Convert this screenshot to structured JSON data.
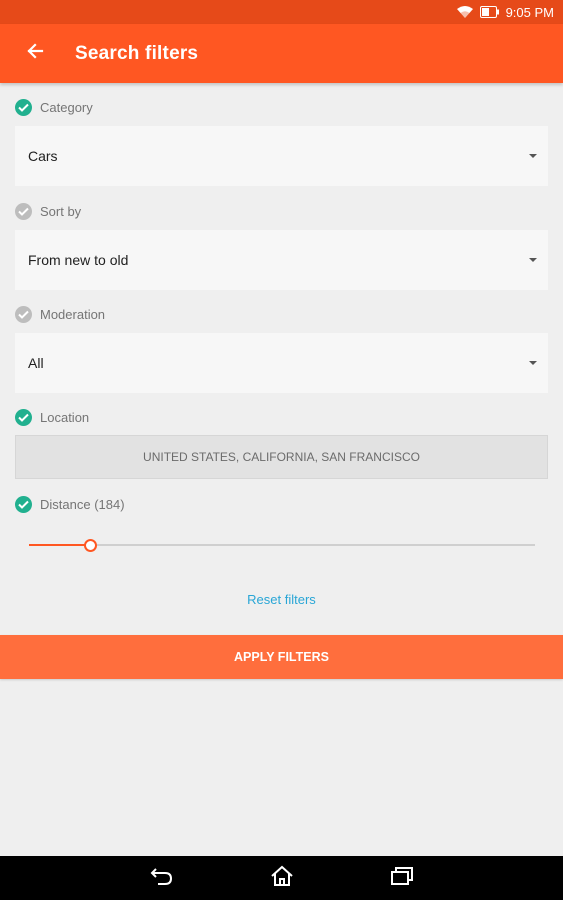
{
  "colors": {
    "status_bar": "#e64a19",
    "app_bar": "#ff5722",
    "check_active": "#21b08f",
    "check_inactive": "#bdbdbd",
    "link": "#29a6d6",
    "apply_button": "#ff6e3d"
  },
  "status_bar": {
    "time": "9:05 PM",
    "icons": [
      "wifi-icon",
      "battery-icon"
    ]
  },
  "app_bar": {
    "title": "Search filters",
    "back_icon": "arrow-left-icon"
  },
  "filters": {
    "category": {
      "label": "Category",
      "value": "Cars",
      "checked": true
    },
    "sort_by": {
      "label": "Sort by",
      "value": "From new to old",
      "checked": false
    },
    "moderation": {
      "label": "Moderation",
      "value": "All",
      "checked": false
    },
    "location": {
      "label": "Location",
      "value": "UNITED STATES, CALIFORNIA, SAN FRANCISCO",
      "checked": true
    },
    "distance": {
      "label": "Distance (184)",
      "checked": true,
      "slider_fraction": 0.12
    }
  },
  "actions": {
    "reset_label": "Reset filters",
    "apply_label": "APPLY FILTERS"
  },
  "nav_bar": {
    "icons": [
      "back-nav-icon",
      "home-icon",
      "recent-apps-icon"
    ]
  }
}
